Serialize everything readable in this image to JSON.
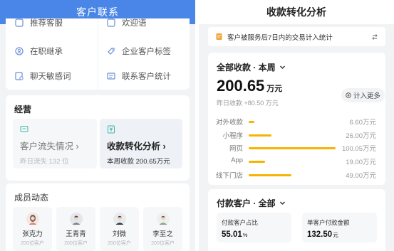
{
  "left": {
    "header_title": "客户联系",
    "tools": [
      {
        "label": "推荐客服",
        "icon": "service-icon"
      },
      {
        "label": "欢迎语",
        "icon": "welcome-icon"
      },
      {
        "label": "在职继承",
        "icon": "inherit-icon"
      },
      {
        "label": "企业客户标签",
        "icon": "tag-icon"
      },
      {
        "label": "聊天敏感词",
        "icon": "sensitive-words-icon"
      },
      {
        "label": "联系客户统计",
        "icon": "stats-icon"
      }
    ],
    "business": {
      "title": "经营",
      "churn": {
        "title": "客户流失情况 ›",
        "sub": "昨日流失 132 位"
      },
      "conversion": {
        "title": "收款转化分析 ›",
        "sub": "本周收款 200.65万元"
      }
    },
    "members": {
      "title": "成员动态",
      "items": [
        {
          "name": "张克力",
          "sub": "200位客户"
        },
        {
          "name": "王青青",
          "sub": "200位客户"
        },
        {
          "name": "刘微",
          "sub": "200位客户"
        },
        {
          "name": "李至之",
          "sub": "200位客户"
        }
      ]
    }
  },
  "right": {
    "header_title": "收款转化分析",
    "notice": "客户被服务后7日内的交易计入统计",
    "income": {
      "filter": "全部收款 · 本周",
      "amount": "200.65",
      "unit": "万元",
      "yesterday": "昨日收款 +80.50 万元",
      "calc_button": "计入更多",
      "channels": [
        {
          "label": "对外收款",
          "value": "6.60万元",
          "amount": 6.6
        },
        {
          "label": "小程序",
          "value": "26.00万元",
          "amount": 26.0
        },
        {
          "label": "网页",
          "value": "100.05万元",
          "amount": 100.05
        },
        {
          "label": "App",
          "value": "19.00万元",
          "amount": 19.0
        },
        {
          "label": "线下门店",
          "value": "49.00万元",
          "amount": 49.0
        }
      ]
    },
    "payers": {
      "filter": "付款客户 · 全部",
      "ratio_label": "付款客户占比",
      "ratio_value": "55.01",
      "ratio_unit": "%",
      "avg_label": "单客户付款金额",
      "avg_value": "132.50",
      "avg_unit": "元"
    }
  },
  "colors": {
    "accent_blue": "#4a86e8",
    "bar_yellow": "#f6b400",
    "icon_blue": "#6a8fd8",
    "icon_teal": "#3bb7a5",
    "notice_orange": "#f3a43b"
  }
}
